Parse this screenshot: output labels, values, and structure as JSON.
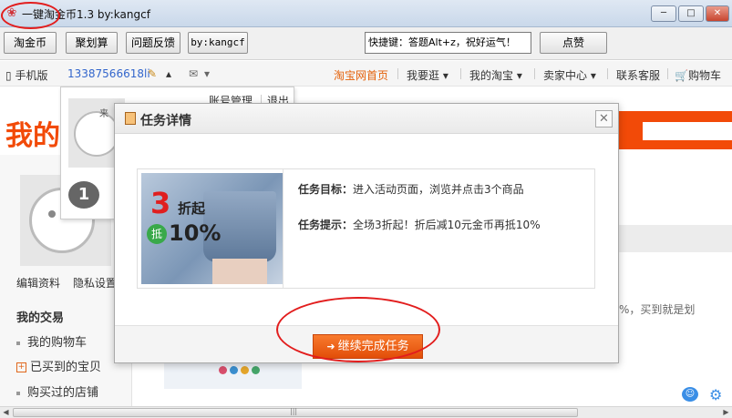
{
  "window": {
    "title": "一键淘金币1.3 by:kangcf",
    "min_label": "─",
    "max_label": "□",
    "close_label": "✕"
  },
  "toolbar": {
    "buttons": [
      "淘金币",
      "聚划算",
      "问题反馈",
      "by:kangcf"
    ],
    "shortcut_text": "快捷键：答题Alt+z，祝好运气！",
    "like_label": "点赞"
  },
  "topnav": {
    "mobile_label": "手机版",
    "account_id": "13387566618li",
    "nav_items": [
      "淘宝网首页",
      "我要逛",
      "我的淘宝",
      "卖家中心",
      "联系客服",
      "购物车"
    ],
    "dropdown_arrows": [
      "▾",
      "▾",
      "▾",
      "▾"
    ]
  },
  "page": {
    "big_title": "我的",
    "left_links": [
      "编辑资料",
      "隐私设置"
    ],
    "trade_heading": "我的交易",
    "trade_items": [
      "我的购物车",
      "已买到的宝贝",
      "购买过的店铺"
    ],
    "right_snippet": "%，买到就是划"
  },
  "account_popup": {
    "manage_label": "账号管理",
    "logout_label": "退出",
    "level_number": "1",
    "avatar_text": "来"
  },
  "modal": {
    "title": "任务详情",
    "close_label": "✕",
    "goal_label": "任务目标：",
    "goal_text": "进入活动页面，浏览并点击3个商品",
    "hint_label": "任务提示：",
    "hint_text": "全场3折起！折后减10元金币再抵10%",
    "promo": {
      "big_number": "3",
      "qi": "折起",
      "di": "抵",
      "percent": "10%"
    },
    "continue_label": "继续完成任务"
  },
  "colors": {
    "taobao_orange": "#f24a08",
    "highlight_red": "#e21d1d",
    "button_orange": "#f87a2d"
  }
}
